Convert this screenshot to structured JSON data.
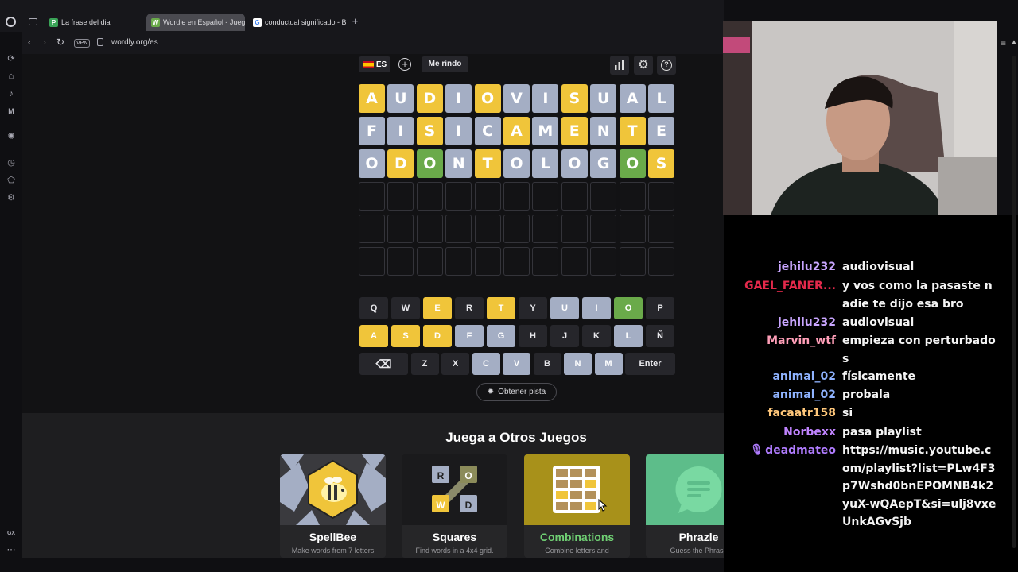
{
  "browser": {
    "tabs": [
      {
        "label": "La frase del dia",
        "icon": "P",
        "color": "#3aa357"
      },
      {
        "label": "Wordle en Español - Jueg",
        "icon": "W",
        "color": "#6aaa4a",
        "active": true
      },
      {
        "label": "conductual significado - B",
        "icon": "G",
        "color": "#dddddd"
      }
    ],
    "url": "wordly.org/es",
    "vpn": "VPN",
    "gx": "GX"
  },
  "game": {
    "lang": "ES",
    "give_up": "Me rindo",
    "board": [
      {
        "letters": [
          "A",
          "U",
          "D",
          "I",
          "O",
          "V",
          "I",
          "S",
          "U",
          "A",
          "L"
        ],
        "states": [
          "y",
          "x",
          "y",
          "x",
          "y",
          "x",
          "x",
          "y",
          "x",
          "x",
          "x"
        ]
      },
      {
        "letters": [
          "F",
          "I",
          "S",
          "I",
          "C",
          "A",
          "M",
          "E",
          "N",
          "T",
          "E"
        ],
        "states": [
          "x",
          "x",
          "y",
          "x",
          "x",
          "y",
          "x",
          "y",
          "x",
          "y",
          "x"
        ]
      },
      {
        "letters": [
          "O",
          "D",
          "O",
          "N",
          "T",
          "O",
          "L",
          "O",
          "G",
          "O",
          "S"
        ],
        "states": [
          "x",
          "y",
          "g",
          "x",
          "y",
          "x",
          "x",
          "x",
          "x",
          "g",
          "y"
        ]
      },
      {
        "letters": [
          "",
          "",
          "",
          "",
          "",
          "",
          "",
          "",
          "",
          "",
          ""
        ],
        "states": [
          "e",
          "e",
          "e",
          "e",
          "e",
          "e",
          "e",
          "e",
          "e",
          "e",
          "e"
        ]
      },
      {
        "letters": [
          "",
          "",
          "",
          "",
          "",
          "",
          "",
          "",
          "",
          "",
          ""
        ],
        "states": [
          "e",
          "e",
          "e",
          "e",
          "e",
          "e",
          "e",
          "e",
          "e",
          "e",
          "e"
        ]
      },
      {
        "letters": [
          "",
          "",
          "",
          "",
          "",
          "",
          "",
          "",
          "",
          "",
          ""
        ],
        "states": [
          "e",
          "e",
          "e",
          "e",
          "e",
          "e",
          "e",
          "e",
          "e",
          "e",
          "e"
        ]
      }
    ],
    "keyboard": [
      [
        {
          "k": "Q",
          "s": ""
        },
        {
          "k": "W",
          "s": ""
        },
        {
          "k": "E",
          "s": "y"
        },
        {
          "k": "R",
          "s": ""
        },
        {
          "k": "T",
          "s": "y"
        },
        {
          "k": "Y",
          "s": ""
        },
        {
          "k": "U",
          "s": "x"
        },
        {
          "k": "I",
          "s": "x"
        },
        {
          "k": "O",
          "s": "g"
        },
        {
          "k": "P",
          "s": ""
        }
      ],
      [
        {
          "k": "A",
          "s": "y"
        },
        {
          "k": "S",
          "s": "y"
        },
        {
          "k": "D",
          "s": "y"
        },
        {
          "k": "F",
          "s": "x"
        },
        {
          "k": "G",
          "s": "x"
        },
        {
          "k": "H",
          "s": ""
        },
        {
          "k": "J",
          "s": ""
        },
        {
          "k": "K",
          "s": ""
        },
        {
          "k": "L",
          "s": "x"
        },
        {
          "k": "Ñ",
          "s": ""
        }
      ],
      [
        {
          "k": "⌫",
          "s": "",
          "w": "back"
        },
        {
          "k": "Z",
          "s": ""
        },
        {
          "k": "X",
          "s": ""
        },
        {
          "k": "C",
          "s": "x"
        },
        {
          "k": "V",
          "s": "x"
        },
        {
          "k": "B",
          "s": ""
        },
        {
          "k": "N",
          "s": "x"
        },
        {
          "k": "M",
          "s": "x"
        },
        {
          "k": "Enter",
          "s": "",
          "w": "enter"
        }
      ]
    ],
    "hint": "Obtener pista",
    "other_title": "Juega a Otros Juegos",
    "games": [
      {
        "title": "SpellBee",
        "sub": "Make words from 7 letters",
        "title_color": "#ffffff"
      },
      {
        "title": "Squares",
        "sub": "Find words in a 4x4 grid.",
        "title_color": "#ffffff"
      },
      {
        "title": "Combinations",
        "sub": "Combine letters and",
        "title_color": "#6fcf73"
      },
      {
        "title": "Phrazle",
        "sub": "Guess the Phrase",
        "title_color": "#ffffff"
      }
    ],
    "squares_letters": [
      "R",
      "O",
      "W",
      "D"
    ]
  },
  "chat": [
    {
      "user": "jehilu232",
      "color": "#c9a6ff",
      "msg": "audiovisual"
    },
    {
      "user": "GAEL_FANER...",
      "color": "#e4294b",
      "msg": "y vos como la pasaste nadie te dijo esa bro"
    },
    {
      "user": "jehilu232",
      "color": "#c9a6ff",
      "msg": "audiovisual"
    },
    {
      "user": "Marvin_wtf",
      "color": "#ff9fb8",
      "msg": "empieza con perturbados"
    },
    {
      "user": "animal_02",
      "color": "#8fb3ff",
      "msg": "físicamente"
    },
    {
      "user": "animal_02",
      "color": "#8fb3ff",
      "msg": "probala"
    },
    {
      "user": "facaatr158",
      "color": "#ffc77a",
      "msg": "si"
    },
    {
      "user": "Norbexx",
      "color": "#c084ff",
      "msg": "pasa playlist"
    },
    {
      "user": "deadmateo",
      "color": "#b07cff",
      "msg": "https://music.youtube.com/playlist?list=PLw4F3p7Wshd0bnEPOMNB4k2yuX-wQAepT&si=ulj8vxeUnkAGvSjb",
      "badge": true
    }
  ]
}
